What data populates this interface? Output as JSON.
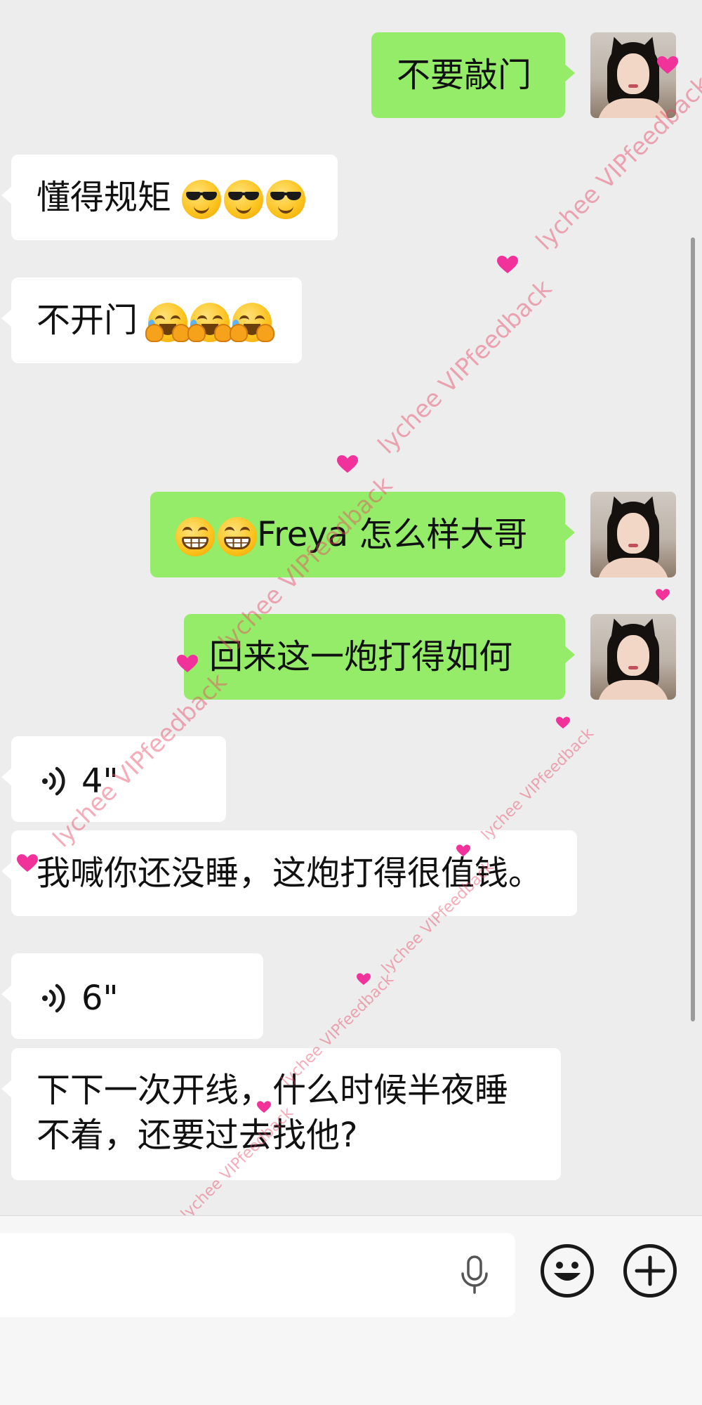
{
  "messages": {
    "m1": {
      "text": "不要敲门"
    },
    "m2": {
      "text": "懂得规矩"
    },
    "m3": {
      "text": "不开门"
    },
    "m4": {
      "text": "Freya 怎么样大哥"
    },
    "m5": {
      "text": "回来这一炮打得如何"
    },
    "m6": {
      "duration": "4\""
    },
    "m7": {
      "text": "我喊你还没睡，这炮打得很值钱。"
    },
    "m8": {
      "duration": "6\""
    },
    "m9": {
      "line1": "下下一次开线，什么时候半夜睡",
      "line2": "不着，还要过去找他?"
    }
  },
  "emojis": {
    "sunglasses": "smiling-face-with-sunglasses-icon",
    "laughing_crying": "rolling-on-floor-laughing-icon",
    "grinning": "grinning-face-with-teeth-icon"
  },
  "watermark": {
    "text": "lychee VIPfeedback"
  },
  "colors": {
    "outgoing_bubble": "#95ec69",
    "incoming_bubble": "#ffffff",
    "chat_background": "#ededed",
    "watermark": "#e84664",
    "heart": "#f0329a"
  }
}
